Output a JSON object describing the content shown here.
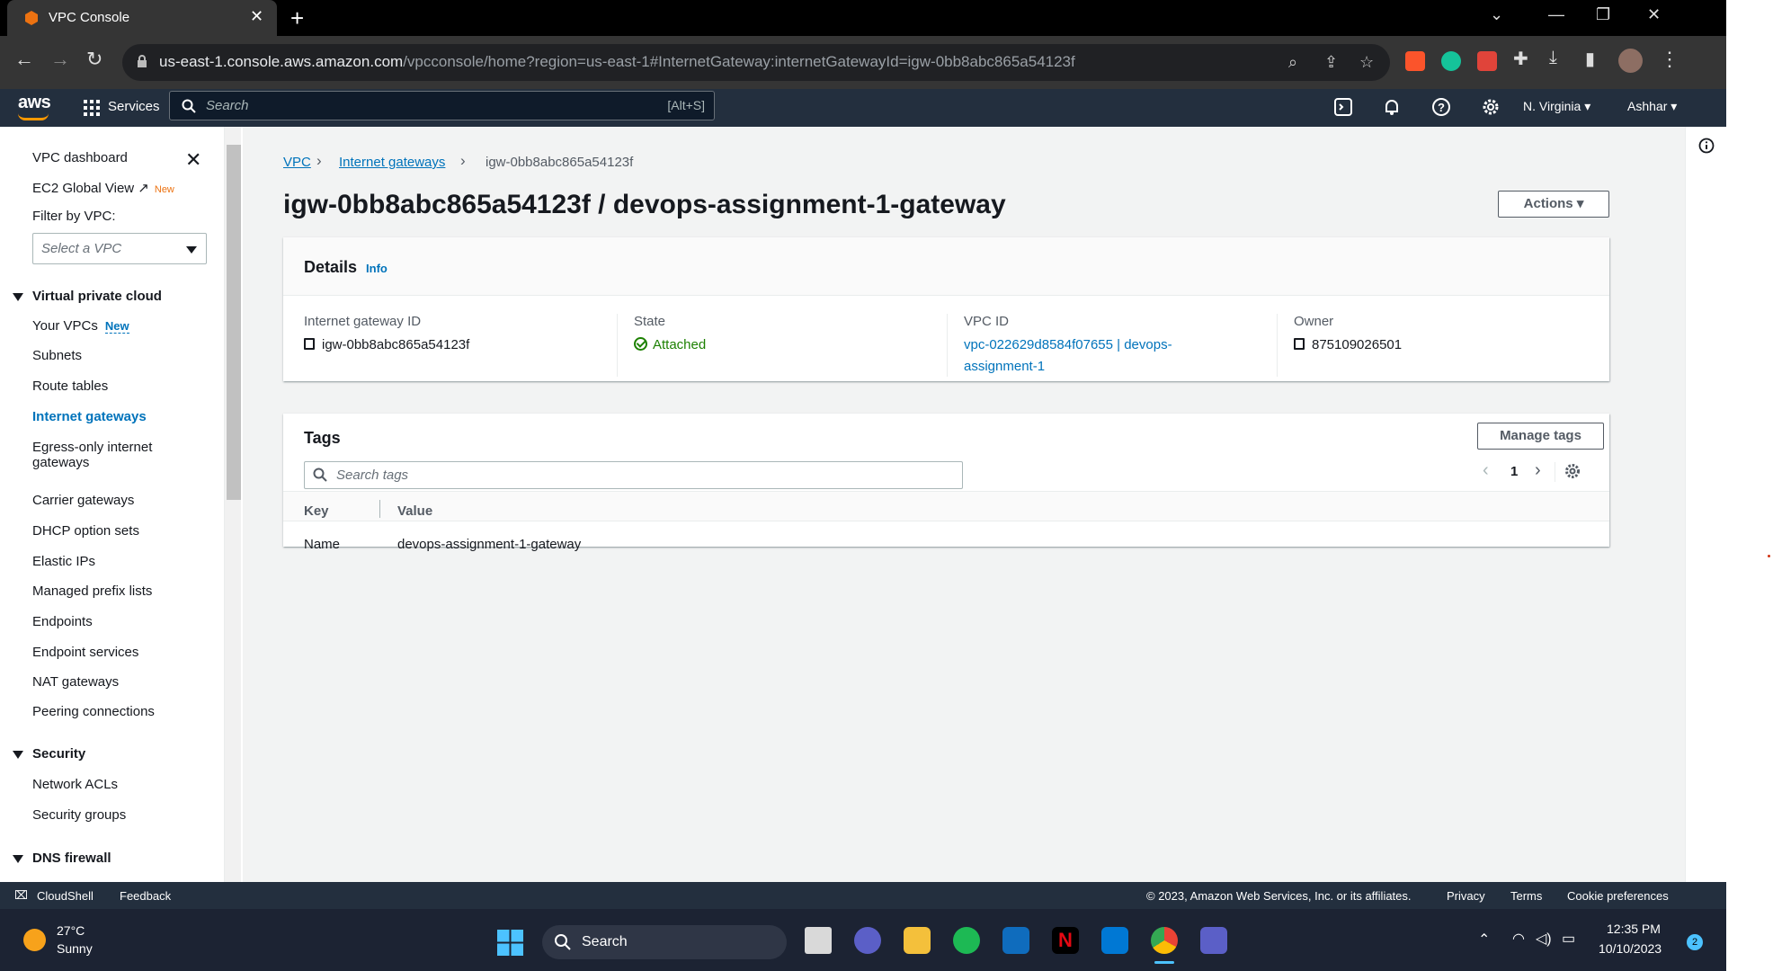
{
  "browser": {
    "tab_title": "VPC Console",
    "url_host": "us-east-1.console.aws.amazon.com",
    "url_rest": "/vpcconsole/home?region=us-east-1#InternetGateway:internetGatewayId=igw-0bb8abc865a54123f"
  },
  "awsnav": {
    "services": "Services",
    "search_placeholder": "Search",
    "search_shortcut": "[Alt+S]",
    "region": "N. Virginia",
    "user": "Ashhar"
  },
  "sidebar": {
    "vpc_dashboard": "VPC dashboard",
    "ec2_global_view": "EC2 Global View",
    "ec2_new": "New",
    "filter_label": "Filter by VPC:",
    "filter_placeholder": "Select a VPC",
    "section_vpc": "Virtual private cloud",
    "your_vpcs": "Your VPCs",
    "your_vpcs_new": "New",
    "items": [
      "Subnets",
      "Route tables",
      "Internet gateways",
      "Egress-only internet",
      "gateways",
      "Carrier gateways",
      "DHCP option sets",
      "Elastic IPs",
      "Managed prefix lists",
      "Endpoints",
      "Endpoint services",
      "NAT gateways",
      "Peering connections"
    ],
    "section_security": "Security",
    "security_items": [
      "Network ACLs",
      "Security groups"
    ],
    "section_dns": "DNS firewall"
  },
  "breadcrumb": {
    "vpc": "VPC",
    "internet_gateways": "Internet gateways",
    "current": "igw-0bb8abc865a54123f"
  },
  "page": {
    "title": "igw-0bb8abc865a54123f / devops-assignment-1-gateway",
    "actions": "Actions"
  },
  "details": {
    "title": "Details",
    "info": "Info",
    "igw_label": "Internet gateway ID",
    "igw_value": "igw-0bb8abc865a54123f",
    "state_label": "State",
    "state_value": "Attached",
    "vpc_label": "VPC ID",
    "vpc_value_1": "vpc-022629d8584f07655 | devops-",
    "vpc_value_2": "assignment-1",
    "owner_label": "Owner",
    "owner_value": "875109026501"
  },
  "tags": {
    "title": "Tags",
    "manage": "Manage tags",
    "search_placeholder": "Search tags",
    "page": "1",
    "col_key": "Key",
    "col_value": "Value",
    "rows": [
      {
        "key": "Name",
        "value": "devops-assignment-1-gateway"
      }
    ]
  },
  "footer": {
    "cloudshell": "CloudShell",
    "feedback": "Feedback",
    "copyright": "© 2023, Amazon Web Services, Inc. or its affiliates.",
    "privacy": "Privacy",
    "terms": "Terms",
    "cookies": "Cookie preferences"
  },
  "taskbar": {
    "temp": "27°C",
    "weather": "Sunny",
    "search": "Search",
    "time": "12:35 PM",
    "date": "10/10/2023",
    "notifications": "2"
  },
  "colors": {
    "aws_nav": "#232f3e",
    "aws_orange": "#ff9900",
    "link": "#0073bb",
    "success": "#1d8102"
  }
}
